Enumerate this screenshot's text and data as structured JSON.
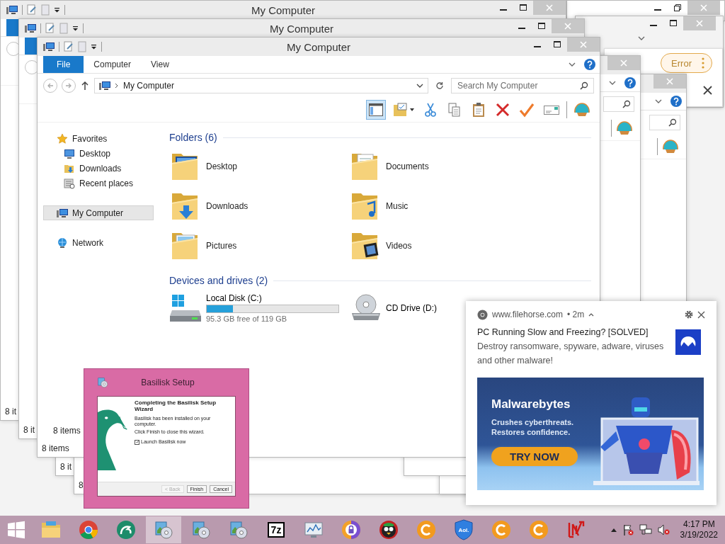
{
  "error_window": {
    "badge": "Error"
  },
  "background_windows": [
    {
      "kind": "plain",
      "title": "My Computer",
      "status": "8 it"
    },
    {
      "kind": "plain",
      "title": "My Computer",
      "status": "8 it"
    },
    {
      "kind": "plain",
      "status": "8 it"
    },
    {
      "kind": "plain",
      "status": "8"
    },
    {
      "kind": "toolbar"
    },
    {
      "kind": "toolbar"
    }
  ],
  "main_window": {
    "title": "My Computer",
    "tabs": [
      {
        "label": "File",
        "selected": true
      },
      {
        "label": "Computer",
        "selected": false
      },
      {
        "label": "View",
        "selected": false
      }
    ],
    "address": "My Computer",
    "search": {
      "placeholder": "Search My Computer"
    },
    "toolbar": [
      {
        "kind": "layout",
        "selected": true
      },
      {
        "kind": "folder-options",
        "selected": false
      },
      {
        "kind": "cut",
        "selected": false
      },
      {
        "kind": "copy",
        "selected": false
      },
      {
        "kind": "paste",
        "selected": false
      },
      {
        "kind": "delete",
        "selected": false
      },
      {
        "kind": "check",
        "selected": false
      },
      {
        "kind": "mail",
        "selected": false
      },
      {
        "kind": "shell",
        "selected": false
      }
    ],
    "navigation": [
      {
        "label": "Favorites",
        "kind": "favorites",
        "selected": false,
        "children": [
          {
            "label": "Desktop",
            "kind": "desktop",
            "selected": false
          },
          {
            "label": "Downloads",
            "kind": "downloads",
            "selected": false
          },
          {
            "label": "Recent places",
            "kind": "recent",
            "selected": false
          }
        ]
      },
      {
        "label": "My Computer",
        "kind": "computer",
        "selected": true
      },
      {
        "label": "Network",
        "kind": "network",
        "selected": false
      }
    ],
    "pane_status": "8 items",
    "groups": [
      {
        "heading": "Folders (6)",
        "items": [
          {
            "name": "Desktop",
            "kind": "desktop"
          },
          {
            "name": "Documents",
            "kind": "documents"
          },
          {
            "name": "Downloads",
            "kind": "downloads"
          },
          {
            "name": "Music",
            "kind": "music"
          },
          {
            "name": "Pictures",
            "kind": "pictures"
          },
          {
            "name": "Videos",
            "kind": "videos"
          }
        ]
      },
      {
        "heading": "Devices and drives (2)",
        "items": [
          {
            "name": "Local Disk (C:)",
            "kind": "hard-disk",
            "level": 0.2,
            "free": "95.3 GB free of 119 GB"
          },
          {
            "name": "CD Drive (D:)",
            "kind": "cd-drive"
          }
        ]
      }
    ],
    "status": "8 items"
  },
  "setup_dialog": {
    "title": "Basilisk Setup",
    "heading": "Completing the Basilisk Setup Wizard",
    "lines": [
      "Basilisk has been installed on your computer.",
      "Click Finish to close this wizard."
    ],
    "checkbox": {
      "label": "Launch Basilisk now",
      "checked": true
    },
    "buttons": [
      {
        "label": "< Back",
        "disabled": true
      },
      {
        "label": "Finish",
        "disabled": false
      },
      {
        "label": "Cancel",
        "disabled": false
      }
    ]
  },
  "notification": {
    "site": "www.filehorse.com",
    "time": "• 2m",
    "title": "PC Running Slow and Freezing? [SOLVED]",
    "body": "Destroy ransomware, spyware, adware, viruses and other malware!",
    "banner": {
      "brand": "Malwarebytes",
      "taglines": [
        "Crushes cyberthreats.",
        "Restores confidence."
      ],
      "button": "TRY NOW"
    }
  },
  "taskbar": {
    "apps": [
      {
        "kind": "explorer",
        "active": false
      },
      {
        "kind": "chrome",
        "active": false
      },
      {
        "kind": "snake",
        "active": false
      },
      {
        "kind": "setup",
        "active": true
      },
      {
        "kind": "setup",
        "active": false
      },
      {
        "kind": "setup",
        "active": false
      },
      {
        "kind": "sevenzip",
        "label": "7z",
        "active": false
      },
      {
        "kind": "monitor",
        "active": false
      },
      {
        "kind": "vault",
        "active": false
      },
      {
        "kind": "bird",
        "active": false
      },
      {
        "kind": "cc",
        "active": false
      },
      {
        "kind": "aol",
        "label": "Aol.",
        "active": false
      },
      {
        "kind": "cc",
        "active": false
      },
      {
        "kind": "cc",
        "active": false
      },
      {
        "kind": "redtool",
        "active": false
      }
    ],
    "tray": [
      {
        "kind": "flag"
      },
      {
        "kind": "network"
      },
      {
        "kind": "volume-muted"
      }
    ],
    "clock": {
      "time": "4:17 PM",
      "date": "3/19/2022"
    }
  }
}
